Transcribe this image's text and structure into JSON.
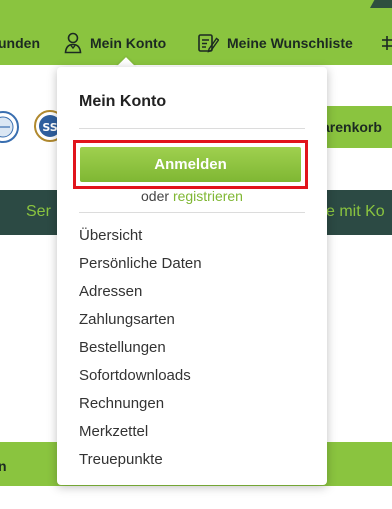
{
  "navbar": {
    "item_left": "unden",
    "account": "Mein Konto",
    "wishlist": "Meine Wunschliste"
  },
  "background": {
    "cart_label": "arenkorb",
    "service_left": "Ser",
    "service_right": "e mit Ko",
    "bottom_left": "n"
  },
  "dropdown": {
    "title": "Mein Konto",
    "login_button": "Anmelden",
    "or_text": "oder",
    "register_link": "registrieren",
    "menu": [
      "Übersicht",
      "Persönliche Daten",
      "Adressen",
      "Zahlungsarten",
      "Bestellungen",
      "Sofortdownloads",
      "Rechnungen",
      "Merkzettel",
      "Treuepunkte"
    ]
  },
  "colors": {
    "brand_green": "#8ac43f",
    "dark_teal": "#2c4a44",
    "highlight_red": "#e1141c"
  }
}
